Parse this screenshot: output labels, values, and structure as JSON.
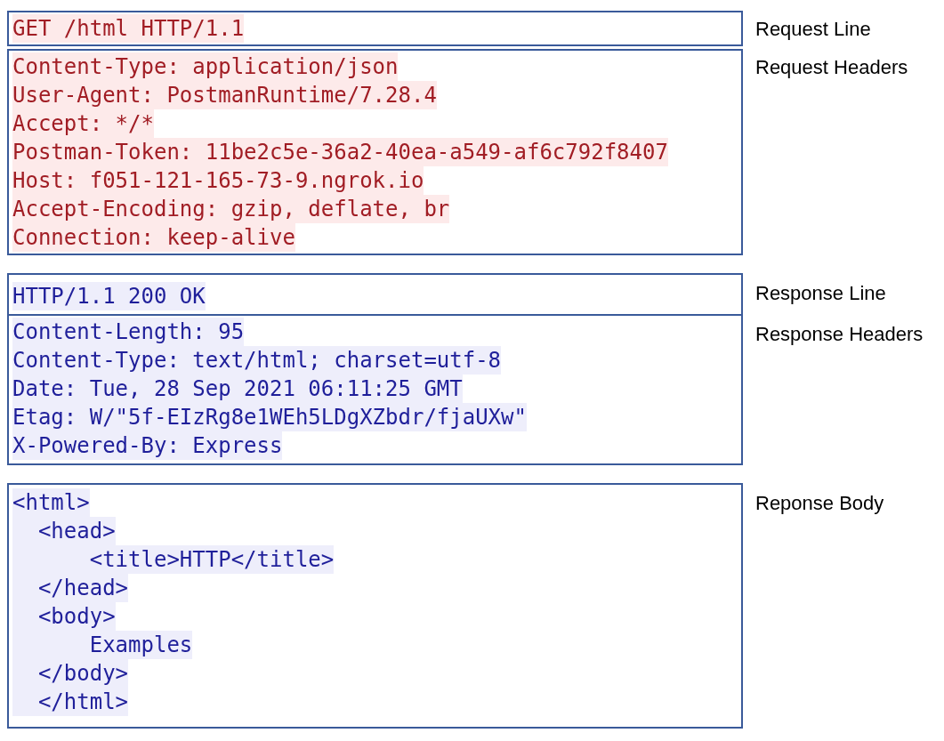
{
  "sections": [
    {
      "kind": "request",
      "parts": [
        {
          "label": "Request Line",
          "lines": [
            "GET /html HTTP/1.1"
          ]
        },
        {
          "label": "Request Headers",
          "lines": [
            "Content-Type: application/json",
            "User-Agent: PostmanRuntime/7.28.4",
            "Accept: */*",
            "Postman-Token: 11be2c5e-36a2-40ea-a549-af6c792f8407",
            "Host: f051-121-165-73-9.ngrok.io",
            "Accept-Encoding: gzip, deflate, br",
            "Connection: keep-alive"
          ]
        }
      ]
    },
    {
      "kind": "response",
      "parts": [
        {
          "label": "Response Line",
          "lines": [
            "HTTP/1.1 200 OK"
          ]
        },
        {
          "label": "Response Headers",
          "lines": [
            "Content-Length: 95",
            "Content-Type: text/html; charset=utf-8",
            "Date: Tue, 28 Sep 2021 06:11:25 GMT",
            "Etag: W/\"5f-EIzRg8e1WEh5LDgXZbdr/fjaUXw\"",
            "X-Powered-By: Express"
          ]
        }
      ]
    },
    {
      "kind": "response",
      "parts": [
        {
          "label": "Reponse Body",
          "lines": [
            "<html>",
            "  <head>",
            "      <title>HTTP</title>",
            "  </head>",
            "  <body>",
            "      Examples",
            "  </body>",
            "  </html>"
          ]
        }
      ]
    }
  ]
}
